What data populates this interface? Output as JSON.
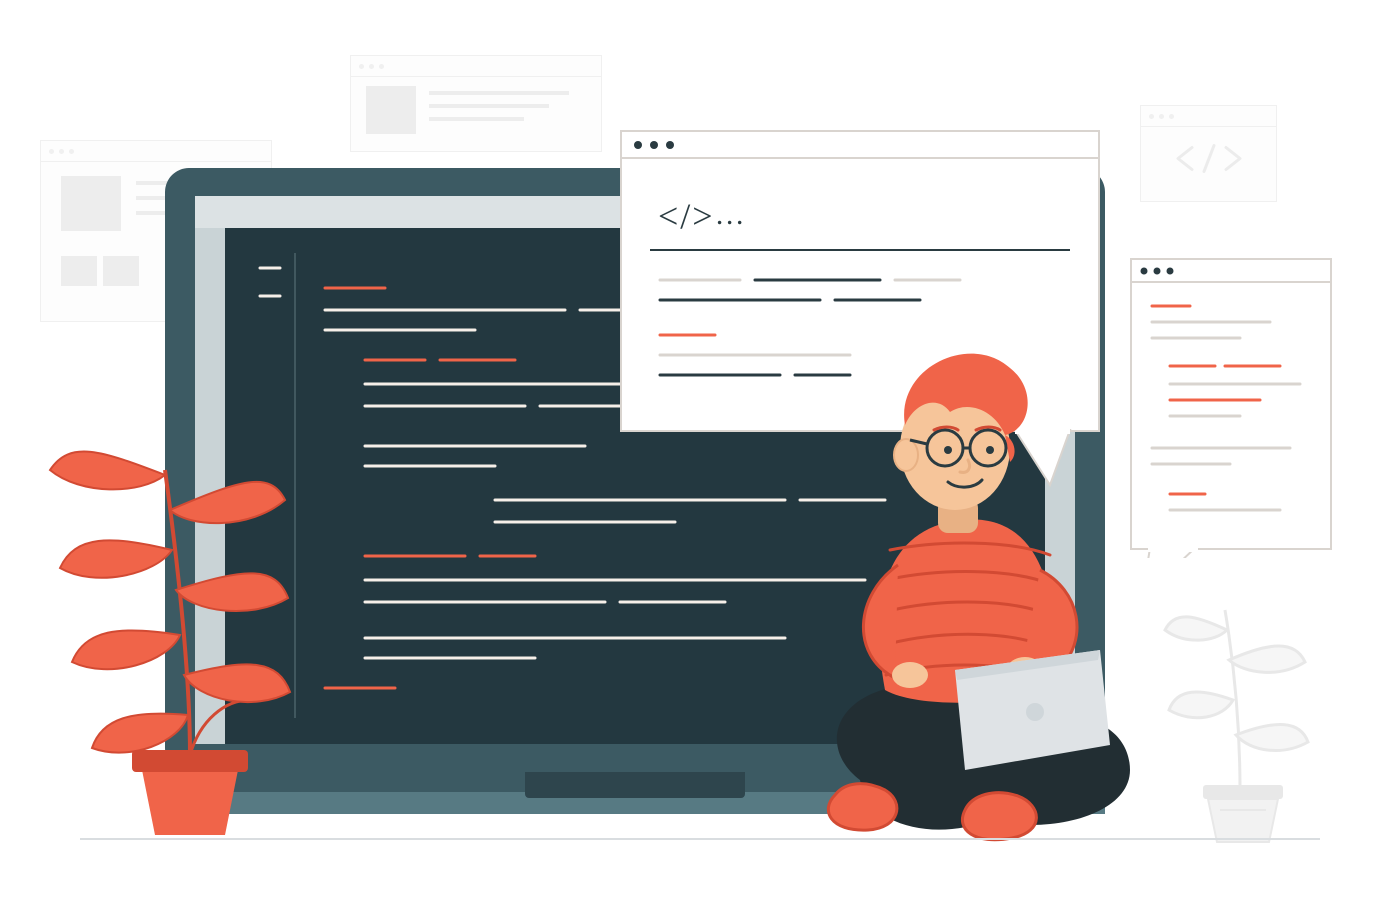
{
  "colors": {
    "teal_dark": "#2e454d",
    "teal_mid": "#3c5a63",
    "teal_light": "#577a83",
    "screen": "#233840",
    "accent": "#f06449",
    "accent_dark": "#d24a33",
    "skin": "#f6c59a",
    "skin_shadow": "#e8b184",
    "hair": "#f06449",
    "pants": "#222e33",
    "laptop_grey": "#dfe3e6",
    "line_white": "#f6efe9",
    "line_paper": "#d9d4cf",
    "border": "#e6e6e6",
    "ghost": "#f0f0f0"
  },
  "speech": {
    "tag": "</>",
    "dots": "…"
  }
}
